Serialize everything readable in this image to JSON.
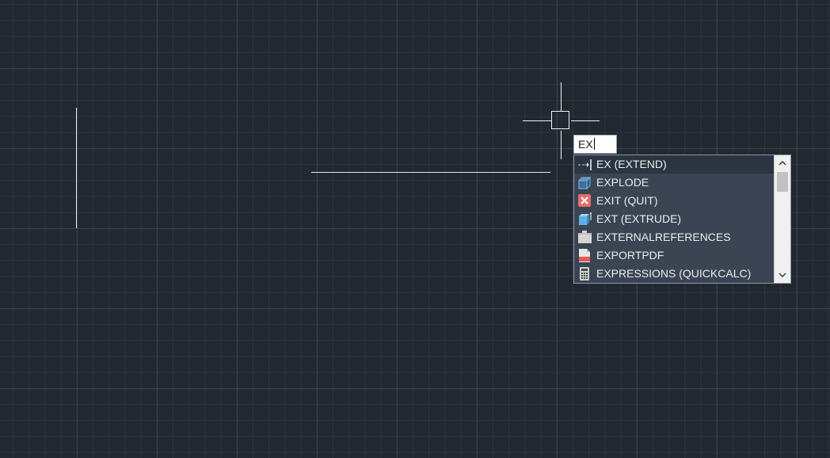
{
  "command_input": {
    "value": "EX"
  },
  "autocomplete": {
    "items": [
      {
        "label": "EX (EXTEND)",
        "icon": "extend-icon"
      },
      {
        "label": "EXPLODE",
        "icon": "explode-icon"
      },
      {
        "label": "EXIT (QUIT)",
        "icon": "exit-icon"
      },
      {
        "label": "EXT (EXTRUDE)",
        "icon": "extrude-icon"
      },
      {
        "label": "EXTERNALREFERENCES",
        "icon": "external-references-icon"
      },
      {
        "label": "EXPORTPDF",
        "icon": "pdf-icon"
      },
      {
        "label": "EXPRESSIONS (QUICKCALC)",
        "icon": "calculator-icon"
      }
    ],
    "selected_index": 0,
    "scroll_position": 0.0
  },
  "colors": {
    "canvas_background": "#212830",
    "list_background": "#3b4453",
    "list_selected": "#2b3441",
    "geometry": "#e8e8e8"
  }
}
